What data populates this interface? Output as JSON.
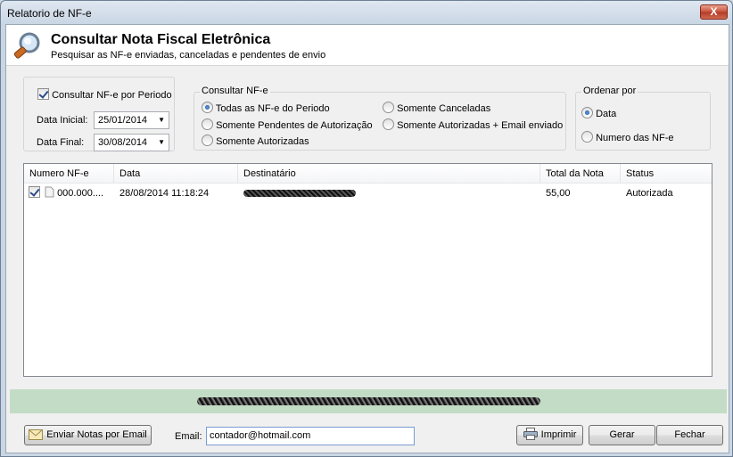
{
  "window": {
    "title": "Relatorio de NF-e",
    "close_label": "X"
  },
  "header": {
    "title": "Consultar Nota Fiscal Eletrônica",
    "subtitle": "Pesquisar as NF-e enviadas, canceladas e pendentes de envio",
    "icon": "magnifier-icon"
  },
  "period": {
    "checkbox_label": "Consultar NF-e por Periodo",
    "checked": true,
    "start_label": "Data Inicial:",
    "start_value": "25/01/2014",
    "end_label": "Data Final:",
    "end_value": "30/08/2014"
  },
  "consult": {
    "legend": "Consultar NF-e",
    "options": [
      "Todas as NF-e do Periodo",
      "Somente Pendentes de Autorização",
      "Somente Autorizadas",
      "Somente Canceladas",
      "Somente Autorizadas + Email enviado"
    ],
    "selected": "Todas as NF-e do Periodo"
  },
  "order": {
    "legend": "Ordenar por",
    "options": [
      "Data",
      "Numero das NF-e"
    ],
    "selected": "Data"
  },
  "table": {
    "columns": [
      "Numero NF-e",
      "Data",
      "Destinatário",
      "Total da Nota",
      "Status"
    ],
    "rows": [
      {
        "checked": true,
        "numero": "000.000....",
        "data": "28/08/2014 11:18:24",
        "destinatario": "",
        "total": "55,00",
        "status": "Autorizada"
      }
    ]
  },
  "status_strip": {
    "color": "#c3dcc5"
  },
  "footer": {
    "send_email_label": "Enviar Notas por Email",
    "email_label": "Email:",
    "email_value": "contador@hotmail.com",
    "print_label": "Imprimir",
    "generate_label": "Gerar",
    "close_label": "Fechar"
  }
}
